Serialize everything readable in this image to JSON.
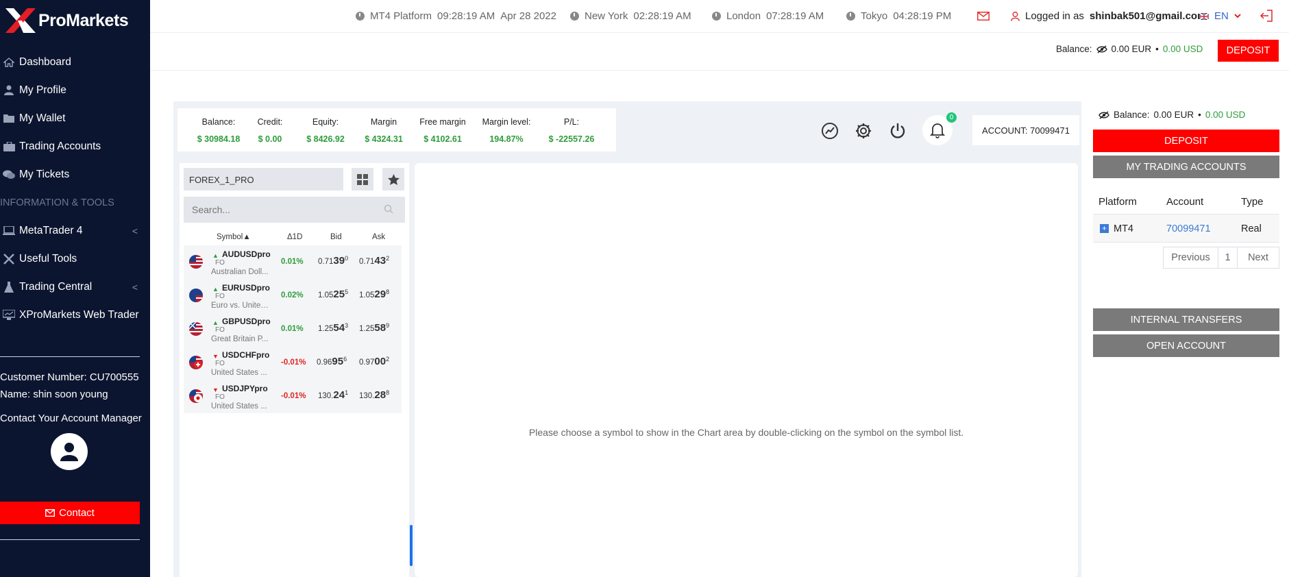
{
  "brand": {
    "name": "ProMarkets"
  },
  "sidebar": {
    "items": [
      {
        "label": "Dashboard",
        "icon": "home-icon"
      },
      {
        "label": "My Profile",
        "icon": "user-icon"
      },
      {
        "label": "My Wallet",
        "icon": "folder-icon"
      },
      {
        "label": "Trading Accounts",
        "icon": "briefcase-icon"
      },
      {
        "label": "My Tickets",
        "icon": "chat-icon"
      }
    ],
    "section": "INFORMATION & TOOLS",
    "tools": [
      {
        "label": "MetaTrader 4",
        "icon": "laptop-icon",
        "chevron": "<"
      },
      {
        "label": "Useful Tools",
        "icon": "tools-icon"
      },
      {
        "label": "Trading Central",
        "icon": "flask-icon",
        "chevron": "<"
      },
      {
        "label": "XProMarkets Web Trader",
        "icon": "monitor-icon"
      }
    ],
    "customer_number": "Customer Number: CU700555",
    "customer_name": "Name: shin soon young",
    "contact_manager": "Contact Your Account Manager",
    "contact_button": "Contact"
  },
  "topbar": {
    "platform_label": "MT4 Platform",
    "platform_time": "09:28:19 AM",
    "platform_date": "Apr 28 2022",
    "ny_label": "New York",
    "ny_time": "02:28:19 AM",
    "london_label": "London",
    "london_time": "07:28:19 AM",
    "tokyo_label": "Tokyo",
    "tokyo_time": "04:28:19 PM",
    "logged_prefix": "Logged in as",
    "user_email": "shinbak501@gmail.com",
    "lang": "EN"
  },
  "subbar": {
    "balance_label": "Balance:",
    "balance_eur": "0.00 EUR",
    "sep": "•",
    "balance_usd": "0.00 USD",
    "deposit": "DEPOSIT"
  },
  "stats": [
    {
      "label": "Balance:",
      "value": "$ 30984.18"
    },
    {
      "label": "Credit:",
      "value": "$ 0.00"
    },
    {
      "label": "Equity:",
      "value": "$ 8426.92"
    },
    {
      "label": "Margin",
      "value": "$ 4324.31"
    },
    {
      "label": "Free margin",
      "value": "$ 4102.61"
    },
    {
      "label": "Margin level:",
      "value": "194.87%"
    },
    {
      "label": "P/L:",
      "value": "$ -22557.26"
    }
  ],
  "notifications": {
    "count": "0"
  },
  "account": {
    "label": "ACCOUNT: 70099471"
  },
  "symbols": {
    "group": "FOREX_1_PRO",
    "search_placeholder": "Search...",
    "headers": {
      "symbol": "Symbol",
      "change": "Δ1D",
      "bid": "Bid",
      "ask": "Ask"
    },
    "rows": [
      {
        "name": "AUDUSDpro",
        "tag": "FO",
        "desc": "Australian Doll...",
        "dir": "up",
        "change": "0.01%",
        "bid_pre": "0.71",
        "bid_big": "39",
        "bid_sup": "0",
        "ask_pre": "0.71",
        "ask_big": "43",
        "ask_sup": "2"
      },
      {
        "name": "EURUSDpro",
        "tag": "FO",
        "desc": "Euro vs. United...",
        "dir": "up",
        "change": "0.02%",
        "bid_pre": "1.05",
        "bid_big": "25",
        "bid_sup": "5",
        "ask_pre": "1.05",
        "ask_big": "29",
        "ask_sup": "8"
      },
      {
        "name": "GBPUSDpro",
        "tag": "FO",
        "desc": "Great Britain P...",
        "dir": "up",
        "change": "0.01%",
        "bid_pre": "1.25",
        "bid_big": "54",
        "bid_sup": "3",
        "ask_pre": "1.25",
        "ask_big": "58",
        "ask_sup": "9"
      },
      {
        "name": "USDCHFpro",
        "tag": "FO",
        "desc": "United States ...",
        "dir": "down",
        "change": "-0.01%",
        "bid_pre": "0.96",
        "bid_big": "95",
        "bid_sup": "6",
        "ask_pre": "0.97",
        "ask_big": "00",
        "ask_sup": "2"
      },
      {
        "name": "USDJPYpro",
        "tag": "FO",
        "desc": "United States ...",
        "dir": "down",
        "change": "-0.01%",
        "bid_pre": "130.",
        "bid_big": "24",
        "bid_sup": "1",
        "ask_pre": "130.",
        "ask_big": "28",
        "ask_sup": "8"
      }
    ]
  },
  "chart": {
    "message": "Please choose a symbol to show in the Chart area by double-clicking on the symbol on the symbol list."
  },
  "right_panel": {
    "balance_label": "Balance:",
    "balance_eur": "0.00 EUR",
    "sep": "•",
    "balance_usd": "0.00 USD",
    "deposit": "DEPOSIT",
    "my_accounts": "MY TRADING ACCOUNTS",
    "table_headers": {
      "platform": "Platform",
      "account": "Account",
      "type": "Type"
    },
    "row": {
      "platform": "MT4",
      "account": "70099471",
      "type": "Real"
    },
    "pagination": {
      "previous": "Previous",
      "page": "1",
      "next": "Next"
    },
    "internal_transfers": "INTERNAL TRANSFERS",
    "open_account": "OPEN ACCOUNT"
  },
  "colors": {
    "accent_red": "#ff0000",
    "sidebar_bg": "#0c1530",
    "positive": "#2e9c3a",
    "negative": "#e02424"
  }
}
